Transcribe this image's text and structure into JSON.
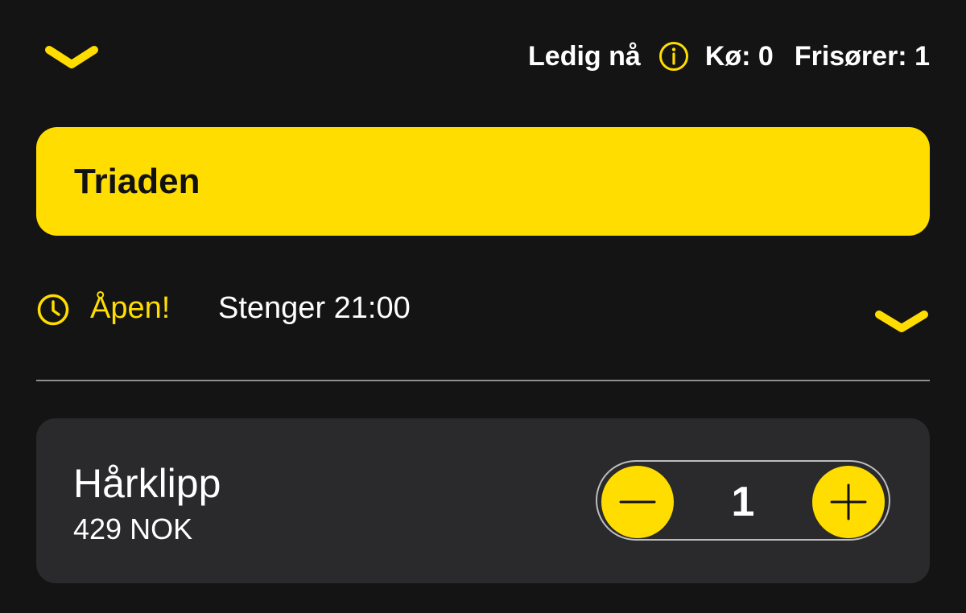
{
  "header": {
    "status_available": "Ledig nå",
    "queue": "Kø: 0",
    "barbers": "Frisører: 1",
    "icons": {
      "collapse": "chevron-down-icon",
      "info": "info-icon"
    }
  },
  "salon": {
    "name": "Triaden"
  },
  "hours": {
    "open_status": "Åpen!",
    "closes": "Stenger 21:00",
    "icons": {
      "clock": "clock-icon",
      "expand": "chevron-down-icon"
    }
  },
  "service": {
    "name": "Hårklipp",
    "price": "429 NOK",
    "quantity": "1",
    "icons": {
      "decrement": "minus-icon",
      "increment": "plus-icon"
    }
  },
  "colors": {
    "accent": "#ffdd00",
    "background": "#141414",
    "card": "#2a292b",
    "text": "#ffffff",
    "divider": "#8f8f8f"
  }
}
